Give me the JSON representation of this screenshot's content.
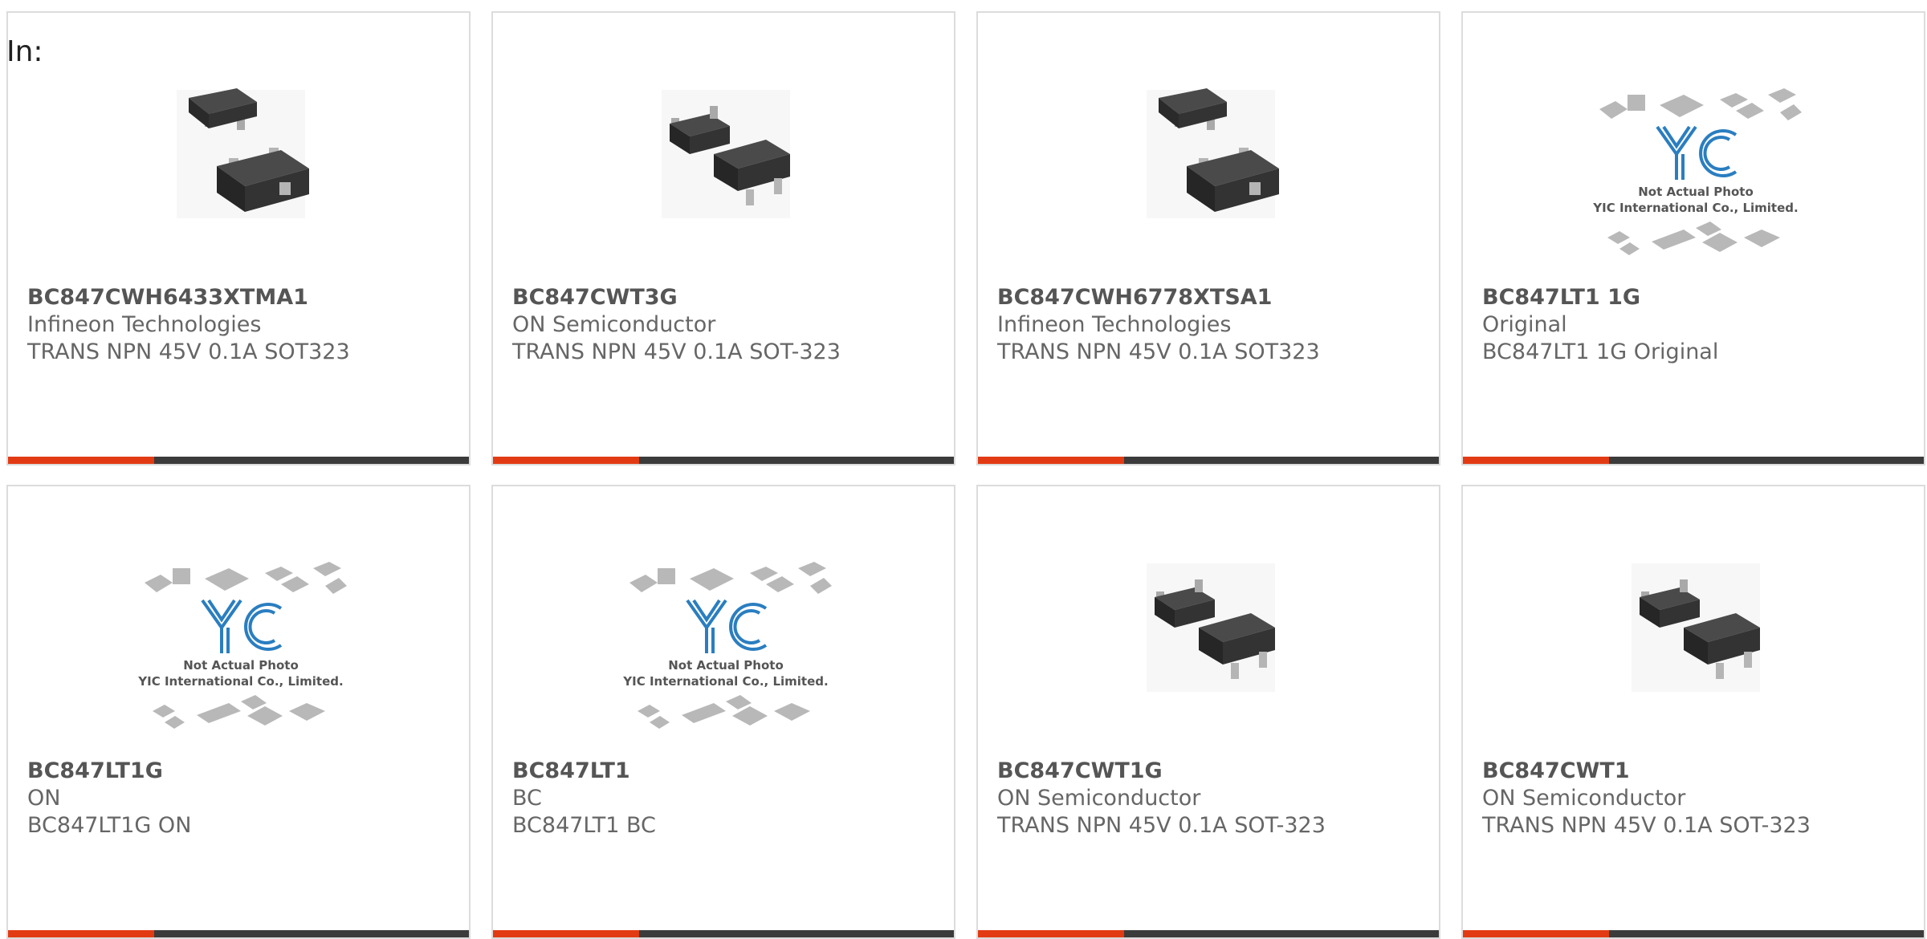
{
  "heading": "In:",
  "colors": {
    "accent": "#e23b14",
    "bar": "#3b3b3b",
    "logo_blue": "#2a7ec0"
  },
  "placeholder": {
    "caption_line1": "Not Actual Photo",
    "caption_line2": "YIC International Co., Limited."
  },
  "cards": [
    {
      "part": "BC847CWH6433XTMA1",
      "manufacturer": "Infineon Technologies",
      "description": "TRANS NPN 45V 0.1A SOT323",
      "image": "sot323-transistor-icon"
    },
    {
      "part": "BC847CWT3G",
      "manufacturer": "ON Semiconductor",
      "description": "TRANS NPN 45V 0.1A SOT-323",
      "image": "sot323-transistor-icon"
    },
    {
      "part": "BC847CWH6778XTSA1",
      "manufacturer": "Infineon Technologies",
      "description": "TRANS NPN 45V 0.1A SOT323",
      "image": "sot323-transistor-icon"
    },
    {
      "part": "BC847LT1 1G",
      "manufacturer": "Original",
      "description": "BC847LT1 1G Original",
      "image": "yic-placeholder-icon"
    },
    {
      "part": "BC847LT1G",
      "manufacturer": "ON",
      "description": "BC847LT1G ON",
      "image": "yic-placeholder-icon"
    },
    {
      "part": "BC847LT1",
      "manufacturer": "BC",
      "description": "BC847LT1 BC",
      "image": "yic-placeholder-icon"
    },
    {
      "part": "BC847CWT1G",
      "manufacturer": "ON Semiconductor",
      "description": "TRANS NPN 45V 0.1A SOT-323",
      "image": "sot323-transistor-icon"
    },
    {
      "part": "BC847CWT1",
      "manufacturer": "ON Semiconductor",
      "description": "TRANS NPN 45V 0.1A SOT-323",
      "image": "sot323-transistor-icon"
    }
  ]
}
